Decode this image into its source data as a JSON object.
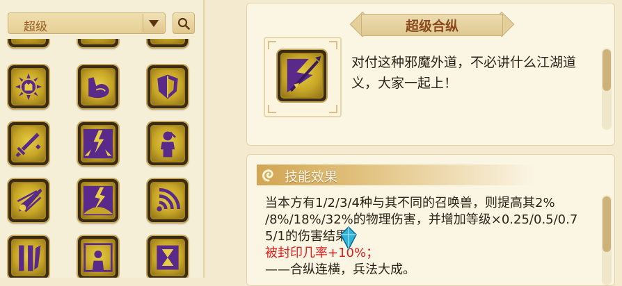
{
  "filter": {
    "selected": "超级"
  },
  "skill_grid": {
    "icons": [
      "sun-tower-icon",
      "flexed-arm-icon",
      "shield-icon",
      "sword-icon",
      "lightning-burst-icon",
      "warrior-figure-icon",
      "flaming-comet-icon",
      "lightning-crack-icon",
      "wifi-wave-icon",
      "claws-icon",
      "dual-figures-icon",
      "hourglass-icon"
    ]
  },
  "skill_detail": {
    "title": "超级合纵",
    "icon": "flag-spear-icon",
    "description": "对付这种邪魔外道，不必讲什么江湖道义，大家一起上！"
  },
  "effect": {
    "header": "技能效果",
    "lines": [
      "当本方有1/2/3/4种与其不同的召唤兽，则提高其2%",
      "/8%/18%/32%的物理伤害，并增加等级×0.25/0.5/0.7",
      "5/1的伤害结果；"
    ],
    "seal_line": "被封印几率+10%；",
    "motto": "——合纵连横，兵法大成。"
  },
  "colors": {
    "gold": "#d4b43a",
    "purple": "#5a2a8a",
    "red": "#e01e1e",
    "title_brown": "#8a4a1d"
  }
}
